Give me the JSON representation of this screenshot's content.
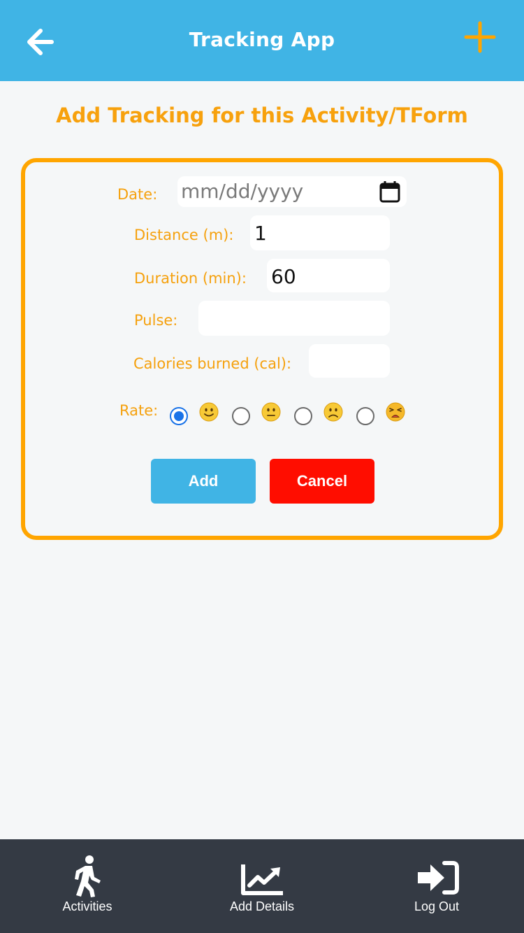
{
  "header": {
    "title": "Tracking App",
    "back_icon": "arrow-left-icon",
    "add_icon": "plus-icon",
    "colors": {
      "background": "#40b4e5",
      "plus": "#ffa500"
    }
  },
  "page": {
    "heading": "Add Tracking for this Activity/TForm"
  },
  "form": {
    "date": {
      "label": "Date:",
      "placeholder": "mm/dd/yyyy",
      "value": ""
    },
    "distance": {
      "label": "Distance (m):",
      "value": "1"
    },
    "duration": {
      "label": "Duration (min):",
      "value": "60"
    },
    "pulse": {
      "label": "Pulse:",
      "value": ""
    },
    "calories": {
      "label": "Calories burned (cal):",
      "value": ""
    },
    "rate": {
      "label": "Rate:",
      "options": [
        {
          "emoji": "slightly-smiling-face",
          "selected": true
        },
        {
          "emoji": "neutral-face",
          "selected": false
        },
        {
          "emoji": "slightly-frowning-face",
          "selected": false
        },
        {
          "emoji": "weary-face",
          "selected": false
        }
      ]
    },
    "buttons": {
      "add": "Add",
      "cancel": "Cancel"
    },
    "colors": {
      "border": "#ffa500",
      "add": "#40b4e5",
      "cancel": "#ff0d00"
    }
  },
  "bottom_nav": {
    "items": [
      {
        "label": "Activities",
        "icon": "walking-person-icon"
      },
      {
        "label": "Add Details",
        "icon": "chart-line-icon"
      },
      {
        "label": "Log Out",
        "icon": "sign-out-icon"
      }
    ]
  }
}
